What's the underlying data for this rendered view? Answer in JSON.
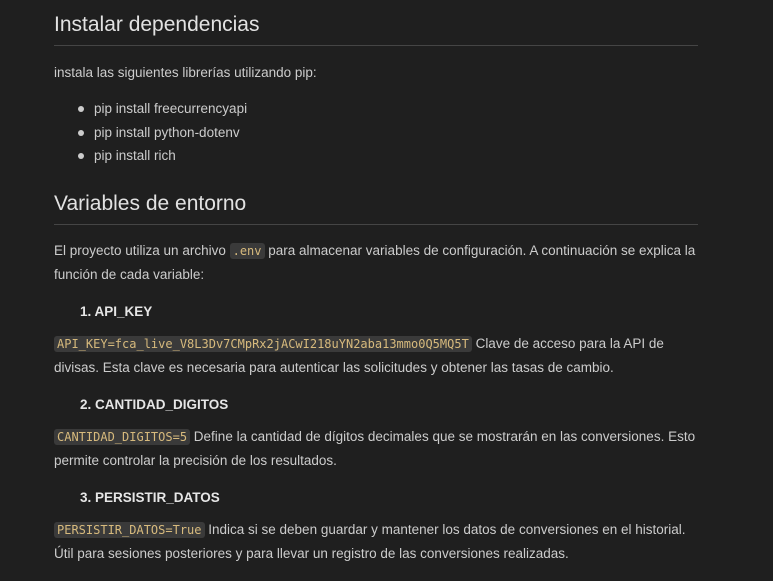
{
  "sections": {
    "deps": {
      "title": "Instalar dependencias",
      "intro": "instala las siguientes librerías utilizando pip:",
      "items": [
        "pip install freecurrencyapi",
        "pip install python-dotenv",
        "pip install rich"
      ]
    },
    "env": {
      "title": "Variables de entorno",
      "intro_before": "El proyecto utiliza un archivo ",
      "intro_code": ".env",
      "intro_after": " para almacenar variables de configuración. A continuación se explica la función de cada variable:",
      "vars": [
        {
          "number": "1.",
          "name": "API_KEY",
          "code": "API_KEY=fca_live_V8L3Dv7CMpRx2jACwI218uYN2aba13mmo0Q5MQ5T",
          "desc": " Clave de acceso para la API de divisas. Esta clave es necesaria para autenticar las solicitudes y obtener las tasas de cambio."
        },
        {
          "number": "2.",
          "name": "CANTIDAD_DIGITOS",
          "code": "CANTIDAD_DIGITOS=5",
          "desc": " Define la cantidad de dígitos decimales que se mostrarán en las conversiones. Esto permite controlar la precisión de los resultados."
        },
        {
          "number": "3.",
          "name": "PERSISTIR_DATOS",
          "code": "PERSISTIR_DATOS=True",
          "desc": " Indica si se deben guardar y mantener los datos de conversiones en el historial. Útil para sesiones posteriores y para llevar un registro de las conversiones realizadas."
        }
      ]
    }
  },
  "colors": {
    "background": "#1f1f1f",
    "text": "#cccccc",
    "heading": "#e2e2e2",
    "code_bg": "#3a3a3a",
    "code_text": "#d7ba7d",
    "divider": "#454545"
  }
}
